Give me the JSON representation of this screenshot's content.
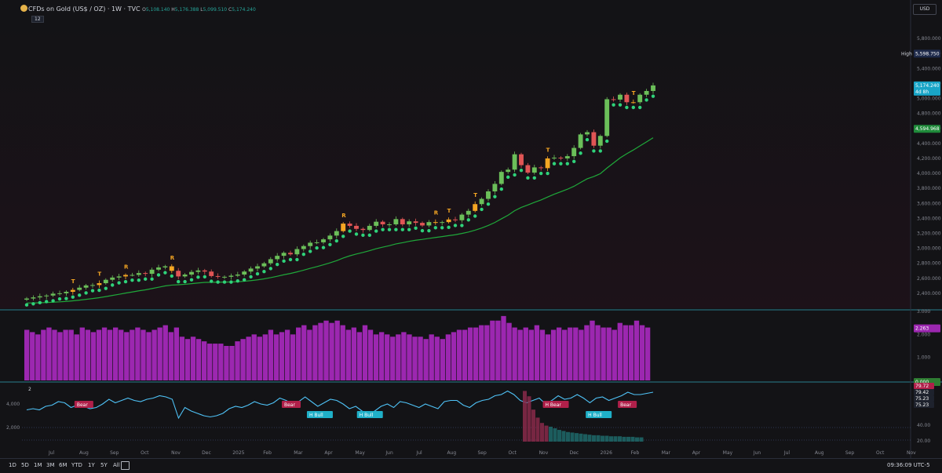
{
  "header": {
    "title": "CFDs on Gold (US$ / OZ) · 1W · TVC",
    "ohlc": [
      {
        "k": "O",
        "v": "5,108.140"
      },
      {
        "k": "H",
        "v": "5,176.388"
      },
      {
        "k": "L",
        "v": "5,099.510"
      },
      {
        "k": "C",
        "v": "5,174.240"
      }
    ],
    "indicator_badge": "12",
    "currency": "USD"
  },
  "colors": {
    "background": "#131316",
    "bull": "#6bbf59",
    "bear": "#e05555",
    "warn": "#f5a623",
    "dot": "#2fd27a",
    "ma": "#1fa83a",
    "volume": "#9c27b0",
    "osc_line": "#4fc3f7",
    "bear_label": "#b0204a",
    "bull_label": "#1fb0c8"
  },
  "chart_data": [
    {
      "type": "candlestick",
      "title": "CFDs on Gold (US$ / OZ) · 1W · TVC",
      "ylim": [
        2200,
        6000
      ],
      "y_ticks": [
        "2,400.000",
        "2,600.000",
        "2,800.000",
        "3,000.000",
        "3,200.000",
        "3,400.000",
        "3,600.000",
        "3,800.000",
        "4,000.000",
        "4,200.000",
        "4,400.000",
        "4,600.000",
        "4,800.000",
        "5,000.000",
        "5,200.000",
        "5,400.000",
        "5,600.000",
        "5,800.000"
      ],
      "x_ticks": [
        "Jul",
        "Aug",
        "Sep",
        "Oct",
        "Nov",
        "Dec",
        "2025",
        "Feb",
        "Mar",
        "Apr",
        "May",
        "Jun",
        "Jul",
        "Aug",
        "Sep",
        "Oct",
        "Nov",
        "Dec",
        "2026",
        "Feb",
        "Mar",
        "Apr",
        "May",
        "Jun",
        "Jul",
        "Aug",
        "Sep",
        "Oct",
        "Nov"
      ],
      "closes": [
        2330,
        2345,
        2360,
        2370,
        2395,
        2400,
        2420,
        2445,
        2475,
        2505,
        2510,
        2535,
        2580,
        2610,
        2625,
        2645,
        2645,
        2670,
        2660,
        2715,
        2745,
        2760,
        2700,
        2625,
        2650,
        2685,
        2705,
        2690,
        2630,
        2620,
        2620,
        2635,
        2650,
        2690,
        2730,
        2760,
        2800,
        2855,
        2900,
        2940,
        2920,
        2990,
        3030,
        3075,
        3080,
        3120,
        3170,
        3230,
        3330,
        3300,
        3260,
        3245,
        3300,
        3355,
        3320,
        3320,
        3390,
        3320,
        3360,
        3340,
        3305,
        3350,
        3345,
        3350,
        3385,
        3375,
        3450,
        3500,
        3590,
        3660,
        3760,
        3860,
        4020,
        4050,
        4255,
        4110,
        4010,
        4080,
        4070,
        4200,
        4210,
        4200,
        4230,
        4340,
        4520,
        4550,
        4370,
        4500,
        4990,
        4985,
        5050,
        4950,
        4950,
        5050,
        5100,
        5174
      ],
      "signals": [
        {
          "i": 7,
          "label": "T"
        },
        {
          "i": 11,
          "label": "T"
        },
        {
          "i": 15,
          "label": "R"
        },
        {
          "i": 22,
          "label": "R"
        },
        {
          "i": 48,
          "label": "R"
        },
        {
          "i": 62,
          "label": "R"
        },
        {
          "i": 64,
          "label": "T"
        },
        {
          "i": 68,
          "label": "T"
        },
        {
          "i": 79,
          "label": "T"
        },
        {
          "i": 92,
          "label": "T"
        },
        {
          "i": 115,
          "label": "R"
        },
        {
          "i": 129,
          "label": "R"
        },
        {
          "i": 142,
          "label": "R"
        },
        {
          "i": 145,
          "label": "T"
        }
      ],
      "price_labels": [
        {
          "text": "High",
          "value": "5,598.750"
        },
        {
          "text": "",
          "value": "5,174.240",
          "sub": "4d 8h"
        },
        {
          "text": "",
          "value": "4,594.968"
        }
      ]
    },
    {
      "type": "bar",
      "name": "volume-pane",
      "ylim": [
        0,
        3.0
      ],
      "y_ticks": [
        "1.000",
        "2.000",
        "3.000"
      ],
      "value_label": "2.263",
      "zero_label": "0.000",
      "values": [
        2.2,
        2.1,
        2.0,
        2.2,
        2.3,
        2.2,
        2.1,
        2.2,
        2.2,
        2.0,
        2.3,
        2.2,
        2.1,
        2.2,
        2.3,
        2.2,
        2.3,
        2.2,
        2.1,
        2.2,
        2.3,
        2.2,
        2.1,
        2.2,
        2.3,
        2.4,
        2.1,
        2.3,
        1.9,
        1.8,
        1.9,
        1.8,
        1.7,
        1.6,
        1.6,
        1.6,
        1.5,
        1.5,
        1.7,
        1.8,
        1.9,
        2.0,
        1.9,
        2.0,
        2.2,
        2.0,
        2.1,
        2.2,
        2.0,
        2.3,
        2.4,
        2.2,
        2.4,
        2.5,
        2.6,
        2.5,
        2.6,
        2.4,
        2.2,
        2.3,
        2.1,
        2.4,
        2.2,
        2.0,
        2.1,
        2.0,
        1.9,
        2.0,
        2.1,
        2.0,
        1.9,
        1.9,
        1.8,
        2.0,
        1.9,
        1.8,
        2.0,
        2.1,
        2.2,
        2.2,
        2.3,
        2.3,
        2.4,
        2.4,
        2.6,
        2.6,
        2.8,
        2.5,
        2.3,
        2.2,
        2.3,
        2.2,
        2.4,
        2.2,
        2.0,
        2.2,
        2.3,
        2.2,
        2.3,
        2.3,
        2.2,
        2.4,
        2.6,
        2.4,
        2.3,
        2.3,
        2.2,
        2.5,
        2.4,
        2.4,
        2.6,
        2.4,
        2.3
      ]
    },
    {
      "type": "line",
      "name": "oscillator-pane",
      "pane_badge": "2",
      "y_ticks": [
        "4,000",
        "2,000"
      ],
      "right_ticks": [
        "40.00",
        "20.00"
      ],
      "right_labels": [
        "79.72",
        "79.42",
        "75.23",
        "75.23"
      ],
      "line": [
        3500,
        3600,
        3500,
        3800,
        3900,
        4200,
        4100,
        3700,
        3900,
        3800,
        3600,
        3700,
        4000,
        4400,
        4100,
        4300,
        4500,
        4300,
        4200,
        4400,
        4500,
        4700,
        4600,
        4400,
        2800,
        3700,
        3400,
        3200,
        3000,
        2900,
        3000,
        3200,
        3600,
        3800,
        3700,
        3900,
        4200,
        4000,
        3900,
        4100,
        4500,
        4300,
        4000,
        4200,
        4600,
        4200,
        3800,
        4100,
        4400,
        4300,
        4000,
        3600,
        3800,
        3400,
        3100,
        3400,
        3800,
        4000,
        3700,
        4200,
        4100,
        3900,
        3700,
        4000,
        3800,
        3600,
        4200,
        4300,
        4300,
        3900,
        3700,
        4100,
        4300,
        4400,
        4700,
        4800,
        5100,
        4800,
        4300,
        4100,
        4300,
        4500,
        4000,
        4300,
        4700,
        4400,
        4500,
        4800,
        4500,
        4100,
        4500,
        4600,
        4300,
        4500,
        4700,
        5000,
        4800,
        4800,
        4900,
        5000
      ],
      "labels": [
        {
          "i": 8,
          "text": "Bear",
          "kind": "bear"
        },
        {
          "i": 37,
          "text": "Bear",
          "kind": "bear"
        },
        {
          "i": 41,
          "text": "H Bull",
          "kind": "bull"
        },
        {
          "i": 48,
          "text": "H Bull",
          "kind": "bull"
        },
        {
          "i": 74,
          "text": "H Bear",
          "kind": "bear"
        },
        {
          "i": 80,
          "text": "H Bull",
          "kind": "bull"
        },
        {
          "i": 84,
          "text": "Bear",
          "kind": "bear"
        }
      ],
      "histogram": [
        0.95,
        0.85,
        0.6,
        0.45,
        0.35,
        0.3,
        0.28,
        0.25,
        0.22,
        0.2,
        0.18,
        0.17,
        0.16,
        0.15,
        0.14,
        0.13,
        0.12,
        0.12,
        0.11,
        0.11,
        0.1,
        0.1,
        0.1,
        0.09,
        0.09,
        0.09,
        0.08,
        0.08
      ]
    }
  ],
  "bottom": {
    "timeframes": [
      "1D",
      "5D",
      "1M",
      "3M",
      "6M",
      "YTD",
      "1Y",
      "5Y",
      "All"
    ],
    "clock": "09:36:09 UTC-5"
  }
}
